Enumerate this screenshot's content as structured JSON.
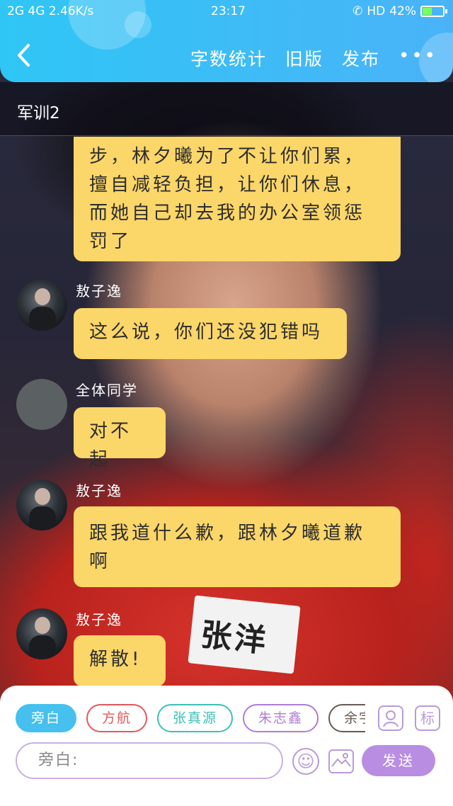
{
  "status_bar": {
    "left": "2G 4G 2.46K/s",
    "time": "23:17",
    "hd": "HD",
    "battery": "42%",
    "battery_level": 0.42
  },
  "header": {
    "actions": [
      "字数统计",
      "旧版",
      "发布"
    ],
    "more": "•••"
  },
  "subtitle": "军训2",
  "messages": [
    {
      "name": "",
      "avatar": "",
      "text": "步，林夕曦为了不让你们累，擅自减轻负担，让你们休息，而她自己却去我的办公室领惩罚了"
    },
    {
      "name": "敖子逸",
      "avatar": "photo",
      "text": "这么说，你们还没犯错吗"
    },
    {
      "name": "全体同学",
      "avatar": "gray",
      "text": "对不起"
    },
    {
      "name": "敖子逸",
      "avatar": "photo",
      "text": "跟我道什么歉，跟林夕曦道歉啊"
    },
    {
      "name": "敖子逸",
      "avatar": "photo",
      "text": "解散!"
    }
  ],
  "background_tag": "张洋",
  "chips": [
    {
      "label": "旁白",
      "color": "#46c0ee"
    },
    {
      "label": "方航",
      "color": "#e2585a"
    },
    {
      "label": "张真源",
      "color": "#3cc0b7"
    },
    {
      "label": "朱志鑫",
      "color": "#b07bd8"
    },
    {
      "label": "余宇涵",
      "color": "#6a5a52"
    }
  ],
  "chip_icons": {
    "person": "person-icon",
    "tag": "标"
  },
  "input": {
    "placeholder": "旁白:"
  },
  "send_label": "发送",
  "colors": {
    "accent": "#2fc6f5",
    "bubble": "#fbd669",
    "send": "#b98ee2"
  }
}
